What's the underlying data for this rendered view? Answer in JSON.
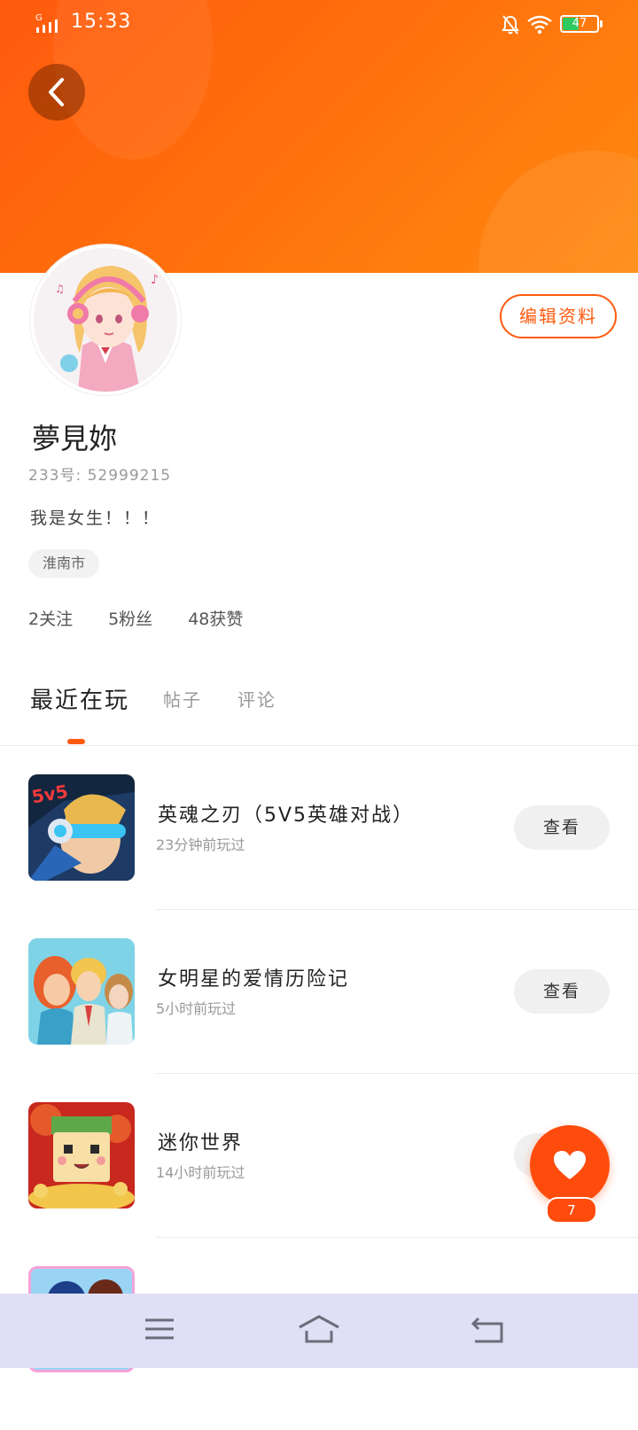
{
  "status_bar": {
    "network": "G",
    "time": "15:33",
    "battery": "47"
  },
  "colors": {
    "accent": "#ff5a0e",
    "header_start": "#ff5a0e",
    "header_end": "#ff8a10",
    "battery_fill": "#2ec95f",
    "navbar_bg": "#dfe0f5"
  },
  "profile": {
    "nickname": "夢見妳",
    "uid": "233号: 52999215",
    "bio": "我是女生！！！",
    "location": "淮南市",
    "edit_label": "编辑资料"
  },
  "stats": {
    "following": "2关注",
    "fans": "5粉丝",
    "likes": "48获赞"
  },
  "tabs": [
    {
      "label": "最近在玩",
      "active": true
    },
    {
      "label": "帖子",
      "active": false
    },
    {
      "label": "评论",
      "active": false
    }
  ],
  "games": [
    {
      "name": "英魂之刃（5V5英雄对战）",
      "time": "23分钟前玩过",
      "button": "查看"
    },
    {
      "name": "女明星的爱情历险记",
      "time": "5小时前玩过",
      "button": "查看"
    },
    {
      "name": "迷你世界",
      "time": "14小时前玩过",
      "button": "查看"
    }
  ],
  "fab": {
    "icon": "heart-icon",
    "count": "7"
  },
  "navbar": {
    "icons": [
      "menu-icon",
      "home-icon",
      "back-icon"
    ]
  }
}
